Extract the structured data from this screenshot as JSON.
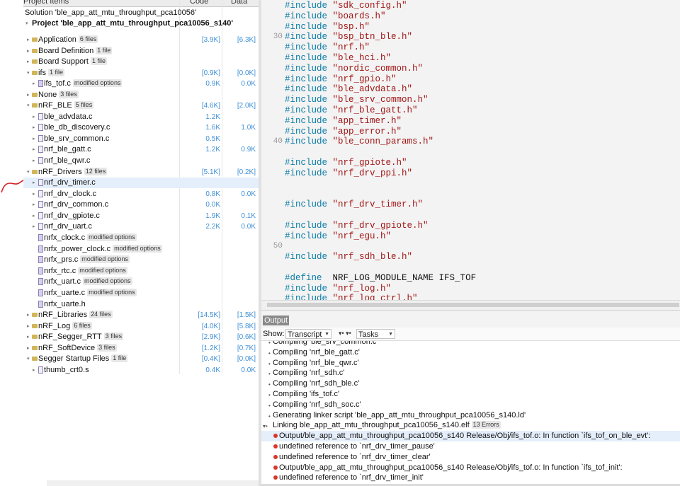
{
  "project_panel": {
    "header": {
      "title": "Project Items",
      "col_code": "Code",
      "col_data": "Data"
    },
    "solution": "Solution 'ble_app_att_mtu_throughput_pca10056'",
    "project": "Project 'ble_app_att_mtu_throughput_pca10056_s140'",
    "rows": [
      {
        "name": "Application",
        "badge": "6 files",
        "code": "[3.9K]",
        "data": "[6.3K]"
      },
      {
        "name": "Board Definition",
        "badge": "1 file",
        "code": "",
        "data": ""
      },
      {
        "name": "Board Support",
        "badge": "1 file",
        "code": "",
        "data": ""
      },
      {
        "name": "ifs",
        "badge": "1 file",
        "code": "[0.9K]",
        "data": "[0.0K]"
      },
      {
        "name": "ifs_tof.c",
        "badge": "modified options",
        "code": "0.9K",
        "data": "0.0K"
      },
      {
        "name": "None",
        "badge": "3 files",
        "code": "",
        "data": ""
      },
      {
        "name": "nRF_BLE",
        "badge": "5 files",
        "code": "[4.6K]",
        "data": "[2.0K]"
      },
      {
        "name": "ble_advdata.c",
        "badge": "",
        "code": "1.2K",
        "data": ""
      },
      {
        "name": "ble_db_discovery.c",
        "badge": "",
        "code": "1.6K",
        "data": "1.0K"
      },
      {
        "name": "ble_srv_common.c",
        "badge": "",
        "code": "0.5K",
        "data": ""
      },
      {
        "name": "nrf_ble_gatt.c",
        "badge": "",
        "code": "1.2K",
        "data": "0.9K"
      },
      {
        "name": "nrf_ble_qwr.c",
        "badge": "",
        "code": "",
        "data": ""
      },
      {
        "name": "nRF_Drivers",
        "badge": "12 files",
        "code": "[5.1K]",
        "data": "[0.2K]"
      },
      {
        "name": "nrf_drv_timer.c",
        "badge": "",
        "code": "",
        "data": ""
      },
      {
        "name": "nrf_drv_clock.c",
        "badge": "",
        "code": "0.8K",
        "data": "0.0K"
      },
      {
        "name": "nrf_drv_common.c",
        "badge": "",
        "code": "0.0K",
        "data": ""
      },
      {
        "name": "nrf_drv_gpiote.c",
        "badge": "",
        "code": "1.9K",
        "data": "0.1K"
      },
      {
        "name": "nrf_drv_uart.c",
        "badge": "",
        "code": "2.2K",
        "data": "0.0K"
      },
      {
        "name": "nrfx_clock.c",
        "badge": "modified options",
        "code": "",
        "data": ""
      },
      {
        "name": "nrfx_power_clock.c",
        "badge": "modified options",
        "code": "",
        "data": ""
      },
      {
        "name": "nrfx_prs.c",
        "badge": "modified options",
        "code": "",
        "data": ""
      },
      {
        "name": "nrfx_rtc.c",
        "badge": "modified options",
        "code": "",
        "data": ""
      },
      {
        "name": "nrfx_uart.c",
        "badge": "modified options",
        "code": "",
        "data": ""
      },
      {
        "name": "nrfx_uarte.c",
        "badge": "modified options",
        "code": "",
        "data": ""
      },
      {
        "name": "nrfx_uarte.h",
        "badge": "",
        "code": "",
        "data": ""
      },
      {
        "name": "nRF_Libraries",
        "badge": "24 files",
        "code": "[14.5K]",
        "data": "[1.5K]"
      },
      {
        "name": "nRF_Log",
        "badge": "6 files",
        "code": "[4.0K]",
        "data": "[5.8K]"
      },
      {
        "name": "nRF_Segger_RTT",
        "badge": "3 files",
        "code": "[2.9K]",
        "data": "[0.6K]"
      },
      {
        "name": "nRF_SoftDevice",
        "badge": "3 files",
        "code": "[1.2K]",
        "data": "[0.7K]"
      },
      {
        "name": "Segger Startup Files",
        "badge": "1 file",
        "code": "[0.4K]",
        "data": "[0.0K]"
      },
      {
        "name": "thumb_crt0.s",
        "badge": "",
        "code": "0.4K",
        "data": "0.0K"
      }
    ]
  },
  "editor": {
    "lines": [
      {
        "num": "",
        "kw": "#include",
        "str": "\"sdk_config.h\"",
        "rest": ""
      },
      {
        "num": "",
        "kw": "#include",
        "str": "\"boards.h\"",
        "rest": ""
      },
      {
        "num": "",
        "kw": "#include",
        "str": "\"bsp.h\"",
        "rest": ""
      },
      {
        "num": "30",
        "kw": "#include",
        "str": "\"bsp_btn_ble.h\"",
        "rest": ""
      },
      {
        "num": "",
        "kw": "#include",
        "str": "\"nrf.h\"",
        "rest": ""
      },
      {
        "num": "",
        "kw": "#include",
        "str": "\"ble_hci.h\"",
        "rest": ""
      },
      {
        "num": "",
        "kw": "#include",
        "str": "\"nordic_common.h\"",
        "rest": ""
      },
      {
        "num": "",
        "kw": "#include",
        "str": "\"nrf_gpio.h\"",
        "rest": ""
      },
      {
        "num": "",
        "kw": "#include",
        "str": "\"ble_advdata.h\"",
        "rest": ""
      },
      {
        "num": "",
        "kw": "#include",
        "str": "\"ble_srv_common.h\"",
        "rest": ""
      },
      {
        "num": "",
        "kw": "#include",
        "str": "\"nrf_ble_gatt.h\"",
        "rest": ""
      },
      {
        "num": "",
        "kw": "#include",
        "str": "\"app_timer.h\"",
        "rest": ""
      },
      {
        "num": "",
        "kw": "#include",
        "str": "\"app_error.h\"",
        "rest": ""
      },
      {
        "num": "40",
        "kw": "#include",
        "str": "\"ble_conn_params.h\"",
        "rest": ""
      },
      {
        "num": "",
        "kw": "",
        "str": "",
        "rest": ""
      },
      {
        "num": "",
        "kw": "#include",
        "str": "\"nrf_gpiote.h\"",
        "rest": ""
      },
      {
        "num": "",
        "kw": "#include",
        "str": "\"nrf_drv_ppi.h\"",
        "rest": ""
      },
      {
        "num": "",
        "kw": "",
        "str": "",
        "rest": ""
      },
      {
        "num": "",
        "kw": "",
        "str": "",
        "rest": ""
      },
      {
        "num": "",
        "kw": "#include",
        "str": "\"nrf_drv_timer.h\"",
        "rest": ""
      },
      {
        "num": "",
        "kw": "",
        "str": "",
        "rest": ""
      },
      {
        "num": "",
        "kw": "#include",
        "str": "\"nrf_drv_gpiote.h\"",
        "rest": ""
      },
      {
        "num": "",
        "kw": "#include",
        "str": "\"nrf_egu.h\"",
        "rest": ""
      },
      {
        "num": "50",
        "kw": "",
        "str": "",
        "rest": ""
      },
      {
        "num": "",
        "kw": "#include",
        "str": "\"nrf_sdh_ble.h\"",
        "rest": ""
      },
      {
        "num": "",
        "kw": "",
        "str": "",
        "rest": ""
      },
      {
        "num": "",
        "kw": "#define",
        "str": "",
        "rest": " NRF_LOG_MODULE_NAME IFS_TOF"
      },
      {
        "num": "",
        "kw": "#include",
        "str": "\"nrf_log.h\"",
        "rest": ""
      },
      {
        "num": "",
        "kw": "#include",
        "str": "\"nrf_log_ctrl.h\"",
        "rest": ""
      }
    ]
  },
  "output_panel": {
    "tab": "Output",
    "show_label": "Show:",
    "show_value": "Transcript",
    "tasks_value": "Tasks",
    "rows": [
      {
        "text": "Compiling 'ble_srv_common.c'",
        "type": "bullet"
      },
      {
        "text": "Compiling 'nrf_ble_gatt.c'",
        "type": "bullet"
      },
      {
        "text": "Compiling 'nrf_ble_qwr.c'",
        "type": "bullet"
      },
      {
        "text": "Compiling 'nrf_sdh.c'",
        "type": "bullet"
      },
      {
        "text": "Compiling 'nrf_sdh_ble.c'",
        "type": "bullet"
      },
      {
        "text": "Compiling 'ifs_tof.c'",
        "type": "bullet"
      },
      {
        "text": "Compiling 'nrf_sdh_soc.c'",
        "type": "bullet"
      },
      {
        "text": "Generating linker script 'ble_app_att_mtu_throughput_pca10056_s140.ld'",
        "type": "bullet"
      },
      {
        "text": "Linking ble_app_att_mtu_throughput_pca10056_s140.elf",
        "badge": "13 Errors",
        "type": "expand"
      },
      {
        "text": "Output/ble_app_att_mtu_throughput_pca10056_s140 Release/Obj/ifs_tof.o: In function `ifs_tof_on_ble_evt':",
        "type": "error"
      },
      {
        "text": "undefined reference to `nrf_drv_timer_pause'",
        "type": "error"
      },
      {
        "text": "undefined reference to `nrf_drv_timer_clear'",
        "type": "error"
      },
      {
        "text": "Output/ble_app_att_mtu_throughput_pca10056_s140 Release/Obj/ifs_tof.o: In function `ifs_tof_init':",
        "type": "error"
      },
      {
        "text": "undefined reference to `nrf_drv_timer_init'",
        "type": "error"
      }
    ]
  },
  "colors": {
    "keyword": "#0a7ca6",
    "string": "#a31515",
    "size_value": "#3f8fd6",
    "error": "#d9362a",
    "selection": "#e5eefb"
  }
}
